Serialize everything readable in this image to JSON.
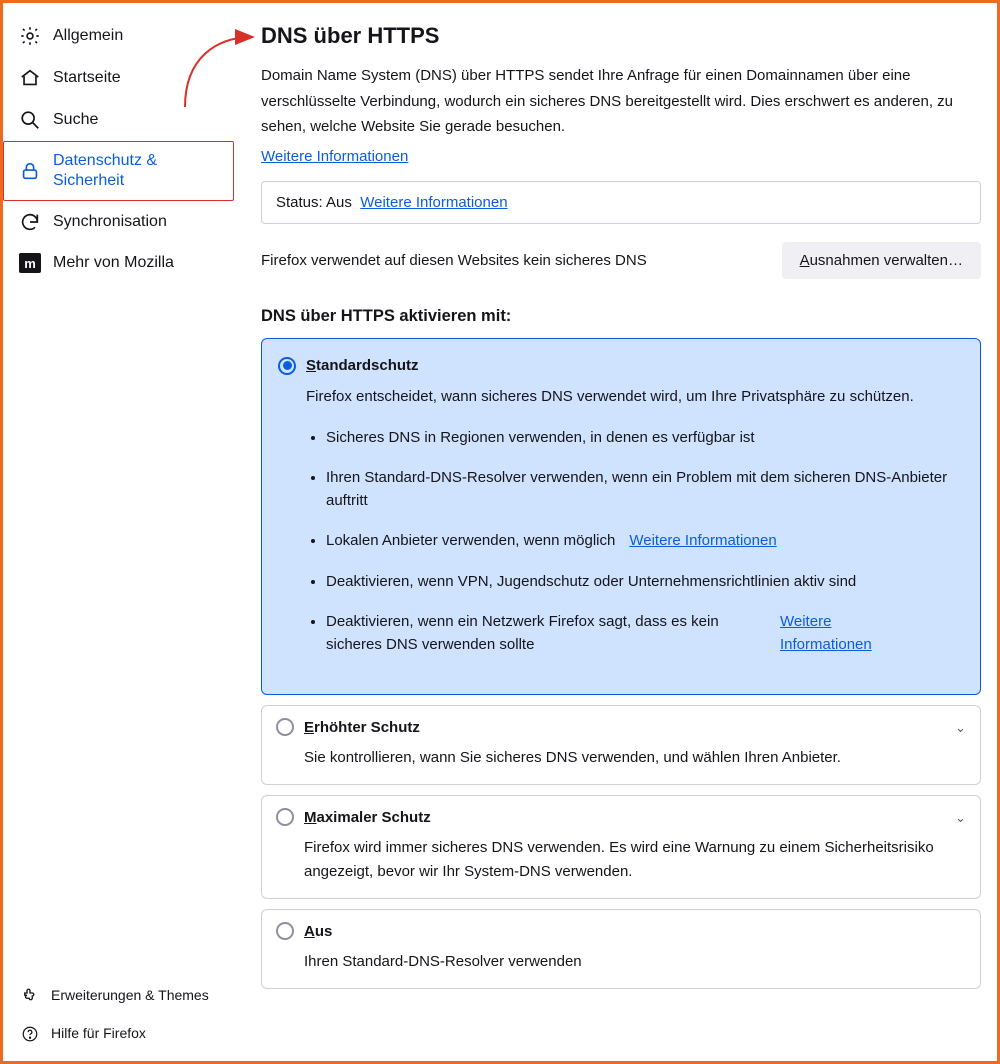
{
  "sidebar": {
    "items": [
      {
        "label": "Allgemein"
      },
      {
        "label": "Startseite"
      },
      {
        "label": "Suche"
      },
      {
        "label": "Datenschutz & Sicherheit"
      },
      {
        "label": "Synchronisation"
      },
      {
        "label": "Mehr von Mozilla"
      }
    ],
    "bottom": [
      {
        "label": "Erweiterungen & Themes"
      },
      {
        "label": "Hilfe für Firefox"
      }
    ]
  },
  "main": {
    "title": "DNS über HTTPS",
    "description": "Domain Name System (DNS) über HTTPS sendet Ihre Anfrage für einen Domainnamen über eine verschlüsselte Verbindung, wodurch ein sicheres DNS bereitgestellt wird. Dies erschwert es anderen, zu sehen, welche Website Sie gerade besuchen.",
    "learn_more": "Weitere Informationen",
    "status_label": "Status:",
    "status_value": "Aus",
    "status_link": "Weitere Informationen",
    "nosec_text": "Firefox verwendet auf diesen Websites kein sicheres DNS",
    "exceptions_btn_pre": "A",
    "exceptions_btn_rest": "usnahmen verwalten…",
    "activate_head": "DNS über HTTPS aktivieren mit:",
    "options": {
      "standard": {
        "accel": "S",
        "rest": "tandardschutz",
        "desc": "Firefox entscheidet, wann sicheres DNS verwendet wird, um Ihre Privatsphäre zu schützen.",
        "bullets": [
          "Sicheres DNS in Regionen verwenden, in denen es verfügbar ist",
          "Ihren Standard-DNS-Resolver verwenden, wenn ein Problem mit dem sicheren DNS-Anbieter auftritt",
          "Lokalen Anbieter verwenden, wenn möglich",
          "Deaktivieren, wenn VPN, Jugendschutz oder Unternehmensrichtlinien aktiv sind",
          "Deaktivieren, wenn ein Netzwerk Firefox sagt, dass es kein sicheres DNS verwenden sollte"
        ],
        "bullet_link3": "Weitere Informationen",
        "bullet_link5": "Weitere Informationen"
      },
      "erhoeht": {
        "accel": "E",
        "rest": "rhöhter Schutz",
        "desc": "Sie kontrollieren, wann Sie sicheres DNS verwenden, und wählen Ihren Anbieter."
      },
      "maximal": {
        "accel": "M",
        "rest": "aximaler Schutz",
        "desc": "Firefox wird immer sicheres DNS verwenden. Es wird eine Warnung zu einem Sicherheitsrisiko angezeigt, bevor wir Ihr System-DNS verwenden."
      },
      "aus": {
        "accel": "A",
        "rest": "us",
        "desc": "Ihren Standard-DNS-Resolver verwenden"
      }
    }
  }
}
